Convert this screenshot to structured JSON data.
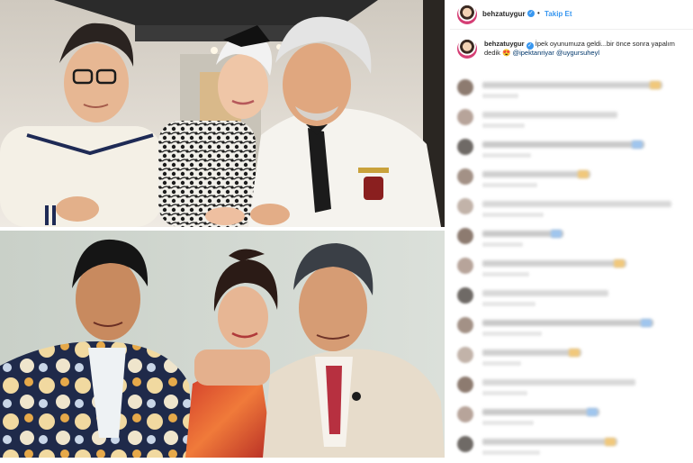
{
  "post": {
    "header": {
      "username": "behzatuygur",
      "verified": true,
      "separator": "•",
      "follow_label": "Takip Et"
    },
    "caption": {
      "username": "behzatuygur",
      "text": "İpek oyunumuza geldi...bir önce sonra yapalım dedik",
      "emoji": "😍",
      "mentions": [
        "@ipektanriyar",
        "@uygursuheyl"
      ]
    },
    "photos": {
      "top": "current-photo-three-people",
      "bottom": "old-photo-three-people"
    },
    "comments_count_visible": 13
  },
  "colors": {
    "link_blue": "#3897f0",
    "mention": "#00376b",
    "text": "#262626"
  }
}
